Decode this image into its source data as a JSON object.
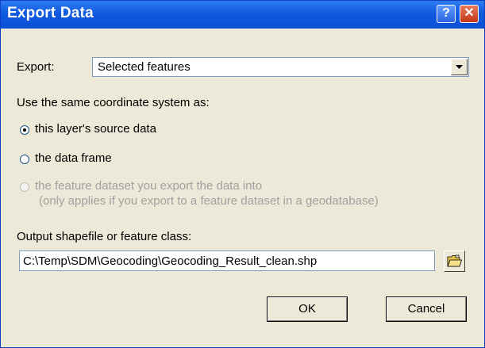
{
  "window": {
    "title": "Export Data",
    "help_label": "?",
    "close_label": "✕"
  },
  "export": {
    "label": "Export:",
    "selected": "Selected features"
  },
  "coord_system": {
    "label": "Use the same coordinate system as:",
    "options": [
      {
        "label": "this layer's source data",
        "checked": true,
        "enabled": true
      },
      {
        "label": "the data frame",
        "checked": false,
        "enabled": true
      },
      {
        "label": "the feature dataset you export the data into",
        "note": "(only applies if you export to a feature dataset in a geodatabase)",
        "checked": false,
        "enabled": false
      }
    ]
  },
  "output": {
    "label": "Output shapefile or feature class:",
    "value": "C:\\Temp\\SDM\\Geocoding\\Geocoding_Result_clean.shp"
  },
  "buttons": {
    "ok": "OK",
    "cancel": "Cancel"
  },
  "colors": {
    "titlebar": "#0a4fd4",
    "dialog_bg": "#ece9d8",
    "field_border": "#7f9db9",
    "disabled_text": "#a0a0a0"
  },
  "icons": {
    "browse": "open-folder-icon",
    "dropdown": "chevron-down-icon"
  }
}
